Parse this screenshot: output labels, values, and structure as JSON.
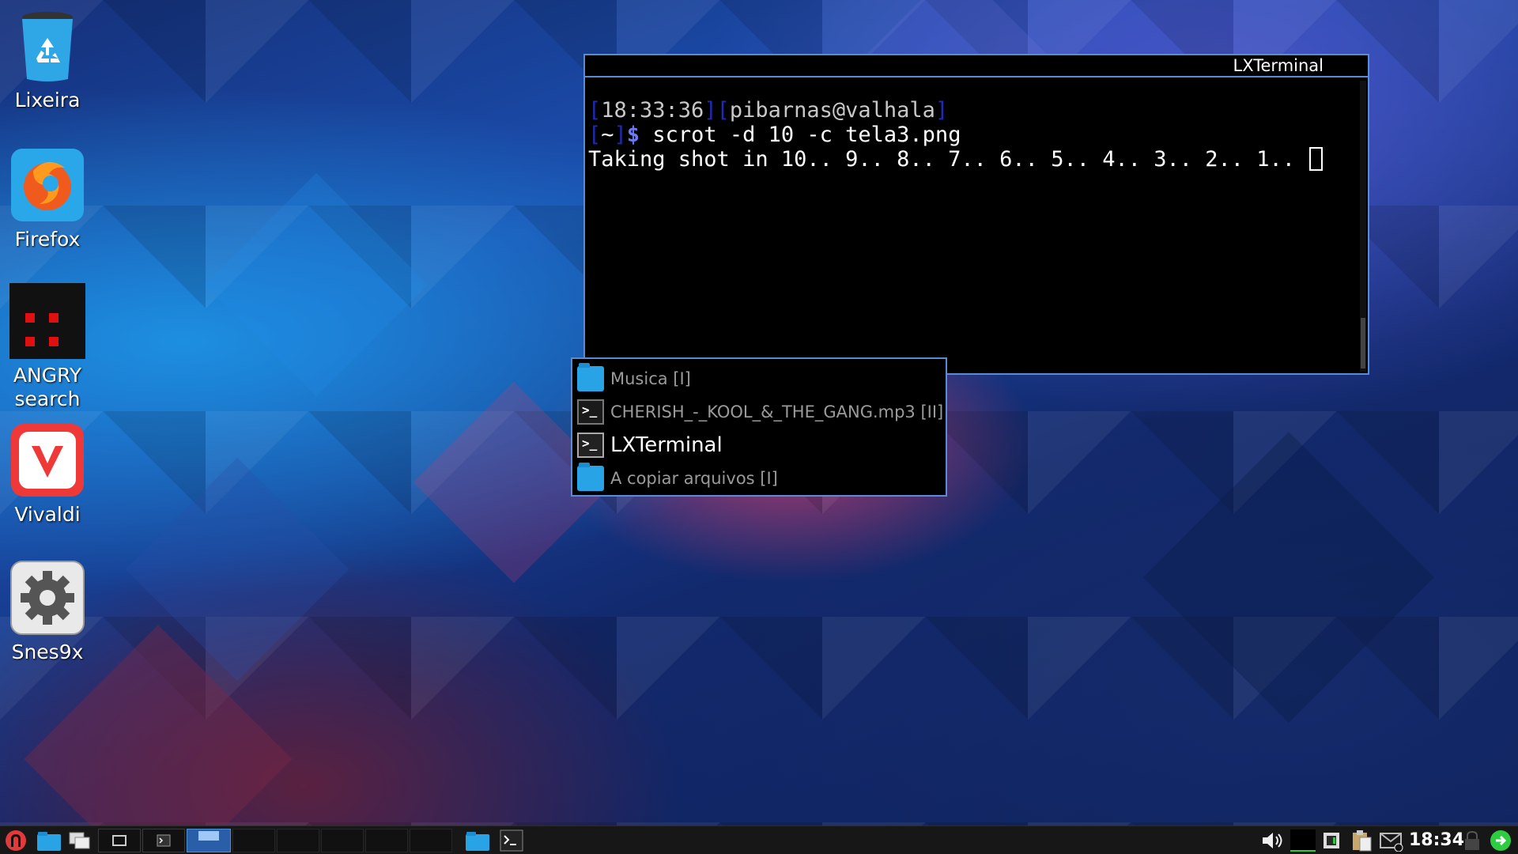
{
  "desktop": {
    "icons": [
      {
        "label": "Lixeira",
        "icon": "trash-icon"
      },
      {
        "label": "Firefox",
        "icon": "firefox-icon"
      },
      {
        "label": "ANGRY\nsearch",
        "icon": "angrysearch-icon"
      },
      {
        "label": "Vivaldi",
        "icon": "vivaldi-icon"
      },
      {
        "label": "Snes9x",
        "icon": "snes9x-gear-icon"
      }
    ]
  },
  "terminal": {
    "title": "LXTerminal",
    "prompt_time": "18:33:36",
    "prompt_user": "pibarnas@valhala",
    "prompt_dir": "~",
    "prompt_symbol": "$",
    "command": " scrot -d 10 -c tela3.png",
    "output": "Taking shot in 10.. 9.. 8.. 7.. 6.. 5.. 4.. 3.. 2.. 1.. "
  },
  "switcher": {
    "items": [
      {
        "label": "Musica [I]",
        "icon": "folder-icon",
        "active": false
      },
      {
        "label": "CHERISH_-_KOOL_&_THE_GANG.mp3 [II]",
        "icon": "terminal-icon",
        "active": false
      },
      {
        "label": "LXTerminal",
        "icon": "terminal-icon",
        "active": true
      },
      {
        "label": "A copiar arquivos [I]",
        "icon": "folder-icon",
        "active": false
      }
    ]
  },
  "taskbar": {
    "clock": "18:34",
    "colors": {
      "menu_button": "#e03a3a",
      "accent": "#4a90d9",
      "logout": "#2ecc40"
    }
  }
}
